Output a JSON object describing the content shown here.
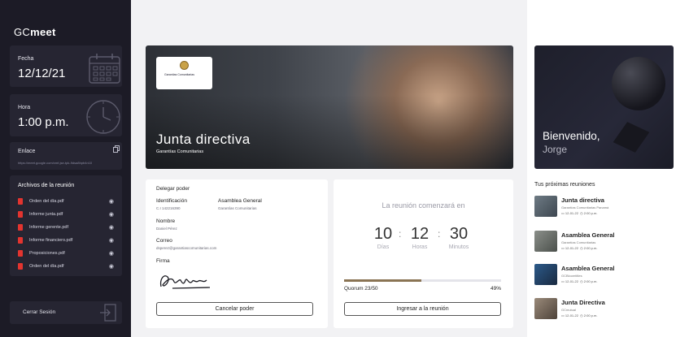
{
  "app": {
    "logo_light": "GC",
    "logo_bold": "meet"
  },
  "sidebar": {
    "date": {
      "label": "Fecha",
      "value": "12/12/21"
    },
    "time": {
      "label": "Hora",
      "value": "1:00 p.m."
    },
    "link": {
      "label": "Enlace",
      "url": "https://meet.google.com/xmf-jse-tpk-9dsa8hpb4n10"
    },
    "files_title": "Archivos de la reunión",
    "files": [
      {
        "name": "Orden del día.pdf"
      },
      {
        "name": "Informe junta.pdf"
      },
      {
        "name": "Informe gerente.pdf"
      },
      {
        "name": "Informe financiero.pdf"
      },
      {
        "name": "Proposiciones.pdf"
      },
      {
        "name": "Orden del día.pdf"
      }
    ],
    "logout": "Cerrar Sesión"
  },
  "hero": {
    "title": "Junta directiva",
    "subtitle": "Garantías Comunitarias",
    "sponsor": "Garantías Comunitarias"
  },
  "delegate": {
    "title": "Delegar poder",
    "id_label": "Identificación",
    "id_value": "C.I 142216390",
    "assembly_label": "Asamblea General",
    "assembly_value": "Garantías Comunitarias",
    "name_label": "Nombre",
    "name_value": "Daniel Pérez",
    "email_label": "Correo",
    "email_value": "dsperez@garantiascomunitarias.com",
    "signature_label": "Firma",
    "cancel_button": "Cancelar poder"
  },
  "countdown": {
    "title": "La reunión comenzará en",
    "days": "10",
    "days_label": "Días",
    "hours": "12",
    "hours_label": "Horas",
    "minutes": "30",
    "minutes_label": "Minutos",
    "quorum_label": "Quorum 23/50",
    "quorum_pct": "49%",
    "quorum_fraction": 0.49,
    "join_button": "Ingresar a la reunión"
  },
  "welcome": {
    "greeting": "Bienvenido,",
    "name": "Jorge"
  },
  "upcoming": {
    "title": "Tus próximas reuniones",
    "meetings": [
      {
        "title": "Junta directiva",
        "org": "Garantías Comunitarias Panamá",
        "date": "12-01-22",
        "time": "2:00 p.m."
      },
      {
        "title": "Asamblea General",
        "org": "Garantías Comunitarias",
        "date": "12-01-22",
        "time": "2:00 p.m."
      },
      {
        "title": "Asamblea General",
        "org": "GCBloomtitles",
        "date": "12-01-22",
        "time": "2:00 p.m."
      },
      {
        "title": "Junta Directiva",
        "org": "GCmutual",
        "date": "12-01-22",
        "time": "2:00 p.m."
      }
    ]
  },
  "colors": {
    "sidebar": "#1c1b26",
    "card": "#262532",
    "accent": "#8a7454",
    "pdf": "#e3342f"
  }
}
